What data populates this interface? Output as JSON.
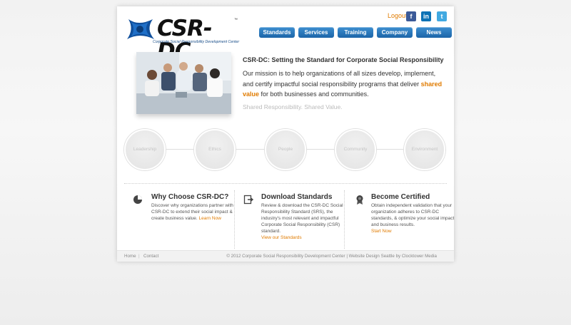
{
  "header": {
    "logo_text": "CSR-DC",
    "logo_tm": "™",
    "logo_tagline": "Corporate Social Responsibility Development Center",
    "logout_label": "Logout",
    "social": {
      "facebook": "f",
      "linkedin": "in",
      "twitter": "t"
    }
  },
  "nav": {
    "items": [
      "Standards",
      "Services",
      "Training",
      "Company",
      "News"
    ]
  },
  "hero": {
    "title": "CSR-DC: Setting the Standard for Corporate Social Responsibility",
    "text_before": "Our mission is to help organizations of all sizes develop, implement, and certify impactful social responsibility programs that deliver ",
    "highlight": "shared value",
    "text_after": " for both businesses and communities.",
    "tagline": "Shared Responsibility. Shared Value."
  },
  "circles": [
    "Leadership",
    "Ethics",
    "People",
    "Community",
    "Environment"
  ],
  "features": [
    {
      "title": "Why Choose CSR-DC?",
      "text": "Discover why organizations partner with CSR-DC to extend their social impact & create business value. ",
      "link": "Learn Now"
    },
    {
      "title": "Download Standards",
      "text": "Review & download the CSR-DC Social Responsibility Standard (SRS), the industry's most relevant and impactful Corporate Social Responsibility (CSR) standard.",
      "link": "View our Standards"
    },
    {
      "title": "Become Certified",
      "text": "Obtain independent validation that your organization adheres to CSR-DC standards, & optimize your social impact and business results.",
      "link": "Start Now"
    }
  ],
  "footer": {
    "home": "Home",
    "sep": "|",
    "contact": "Contact",
    "copyright": "© 2012 Corporate Social Responsibility Development Center | Website Design Seattle by Clocktower Media"
  },
  "colors": {
    "accent_orange": "#e07b00",
    "nav_blue": "#1c65a8"
  }
}
